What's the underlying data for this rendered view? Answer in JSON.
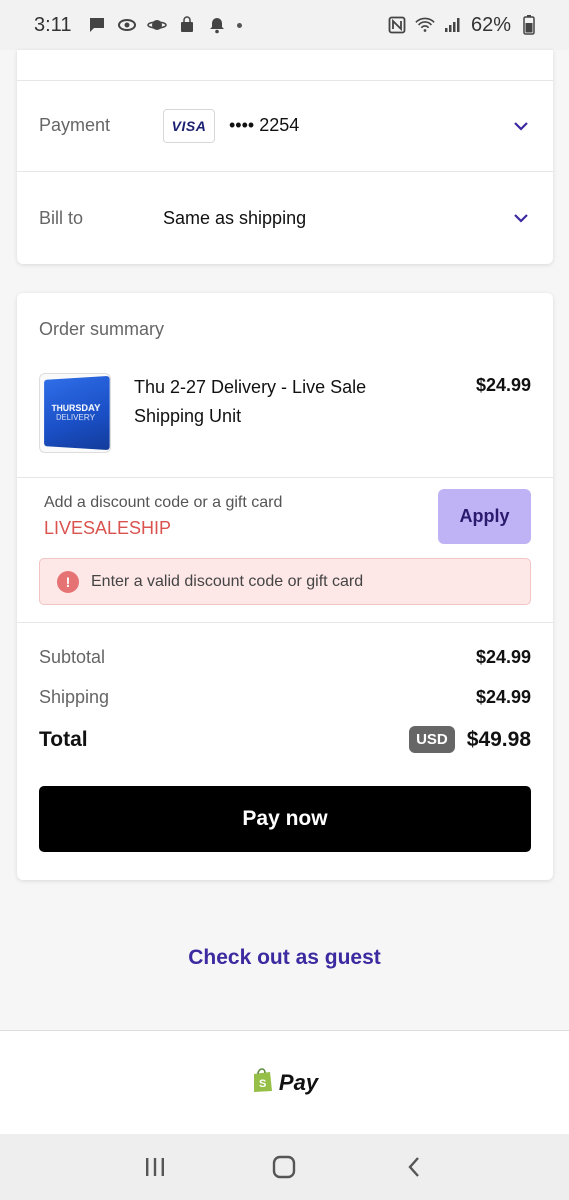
{
  "status_bar": {
    "time": "3:11",
    "battery": "62%"
  },
  "checkout": {
    "payment": {
      "label": "Payment",
      "card_brand": "VISA",
      "card_number": "•••• 2254"
    },
    "bill_to": {
      "label": "Bill to",
      "value": "Same as shipping"
    }
  },
  "summary": {
    "title": "Order summary",
    "product": {
      "name": "Thu 2-27 Delivery - Live Sale Shipping Unit",
      "price": "$24.99",
      "thumb_text_1": "THURSDAY",
      "thumb_text_2": "DELIVERY"
    },
    "discount": {
      "label": "Add a discount code or a gift card",
      "value": "LIVESALESHIP",
      "apply_label": "Apply",
      "error": "Enter a valid discount code or gift card"
    },
    "subtotal_label": "Subtotal",
    "subtotal": "$24.99",
    "shipping_label": "Shipping",
    "shipping": "$24.99",
    "total_label": "Total",
    "currency": "USD",
    "total": "$49.98",
    "pay_label": "Pay now"
  },
  "guest_link": "Check out as guest",
  "shop_pay": {
    "label": "Pay",
    "brand_color": "#5a31f4",
    "bag_color": "#95bf47"
  },
  "colors": {
    "accent": "#3b2aa0",
    "error": "#d9534f",
    "apply_button": "#c0b3f5"
  }
}
